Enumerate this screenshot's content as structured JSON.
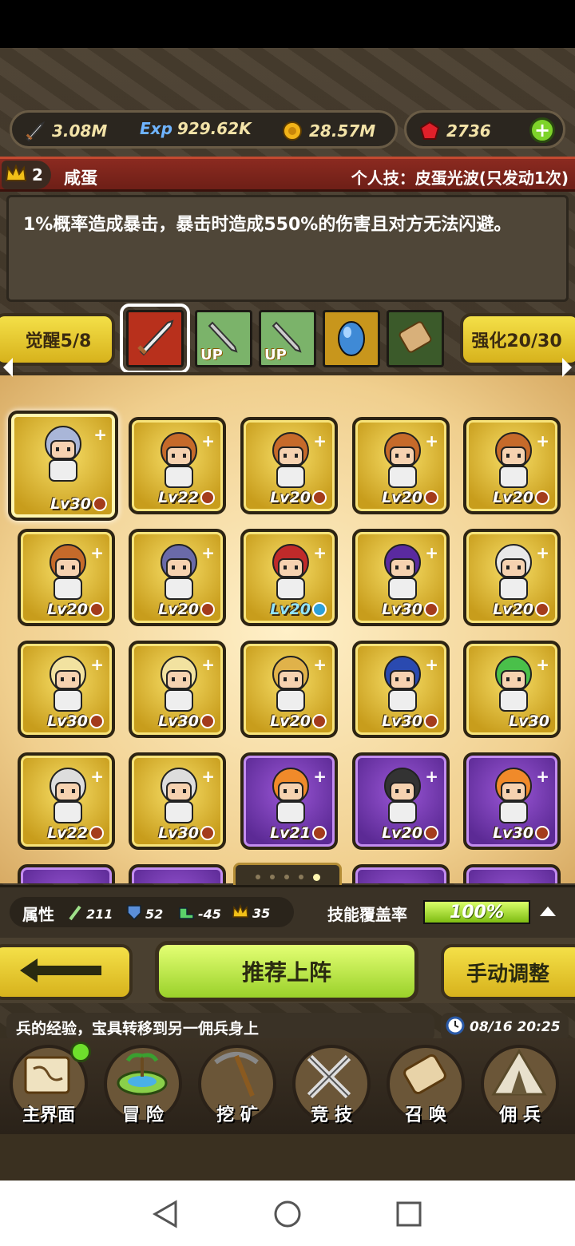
{
  "resources": {
    "attack": "3.08M",
    "exp_label": "Exp",
    "exp": "929.62K",
    "gold": "28.57M",
    "gems": "2736"
  },
  "hero": {
    "rank": "2",
    "name": "咸蛋",
    "skill": "个人技：皮蛋光波(只发动1次)",
    "description": "1%概率造成暴击，暴击时造成550%的伤害且对方无法闪避。"
  },
  "buttons": {
    "awaken": "觉醒5/8",
    "enhance": "强化20/30",
    "recommend": "推荐上阵",
    "manual": "手动调整"
  },
  "equipment": [
    {
      "icon": "sword-icon",
      "tag": ""
    },
    {
      "icon": "sword-up-icon",
      "tag": "UP"
    },
    {
      "icon": "sword-up-icon",
      "tag": "UP"
    },
    {
      "icon": "egg-icon",
      "tag": ""
    },
    {
      "icon": "scroll-icon",
      "tag": ""
    }
  ],
  "mercenaries": [
    {
      "level": "Lv30",
      "rarity": "gold",
      "badge": "red"
    },
    {
      "level": "Lv22",
      "rarity": "gold",
      "badge": "red"
    },
    {
      "level": "Lv20",
      "rarity": "gold",
      "badge": "red"
    },
    {
      "level": "Lv20",
      "rarity": "gold",
      "badge": "red"
    },
    {
      "level": "Lv20",
      "rarity": "gold",
      "badge": "red"
    },
    {
      "level": "Lv20",
      "rarity": "gold",
      "badge": "red"
    },
    {
      "level": "Lv20",
      "rarity": "gold",
      "badge": "red"
    },
    {
      "level": "Lv20",
      "rarity": "gold",
      "badge": "blue"
    },
    {
      "level": "Lv30",
      "rarity": "gold",
      "badge": "red"
    },
    {
      "level": "Lv20",
      "rarity": "gold",
      "badge": "red"
    },
    {
      "level": "Lv30",
      "rarity": "gold",
      "badge": "red"
    },
    {
      "level": "Lv30",
      "rarity": "gold",
      "badge": "red"
    },
    {
      "level": "Lv20",
      "rarity": "gold",
      "badge": "red"
    },
    {
      "level": "Lv30",
      "rarity": "gold",
      "badge": "red"
    },
    {
      "level": "Lv30",
      "rarity": "gold",
      "badge": "none"
    },
    {
      "level": "Lv22",
      "rarity": "gold",
      "badge": "red"
    },
    {
      "level": "Lv30",
      "rarity": "gold",
      "badge": "red"
    },
    {
      "level": "Lv21",
      "rarity": "purple",
      "badge": "red"
    },
    {
      "level": "Lv20",
      "rarity": "purple",
      "badge": "red"
    },
    {
      "level": "Lv30",
      "rarity": "purple",
      "badge": "red"
    }
  ],
  "stats": {
    "label": "属性",
    "attack": "211",
    "defense": "52",
    "speed": "-45",
    "crown": "35",
    "coverage_label": "技能覆盖率",
    "coverage": "100%",
    "coverage_fraction": 1.0
  },
  "ticker": {
    "text": "兵的经验，宝具转移到另一佣兵身上",
    "time": "08/16 20:25"
  },
  "nav": [
    {
      "label": "主界面",
      "icon": "map-icon"
    },
    {
      "label": "冒 险",
      "icon": "island-icon"
    },
    {
      "label": "挖 矿",
      "icon": "pickaxe-icon"
    },
    {
      "label": "竞 技",
      "icon": "crossed-swords-icon"
    },
    {
      "label": "召 唤",
      "icon": "scroll-icon"
    },
    {
      "label": "佣 兵",
      "icon": "tent-icon"
    }
  ],
  "colors": {
    "gold": "#d7b21c",
    "green": "#9ad12a",
    "red_bar": "#8b2a20",
    "purple": "#5c2a95"
  }
}
